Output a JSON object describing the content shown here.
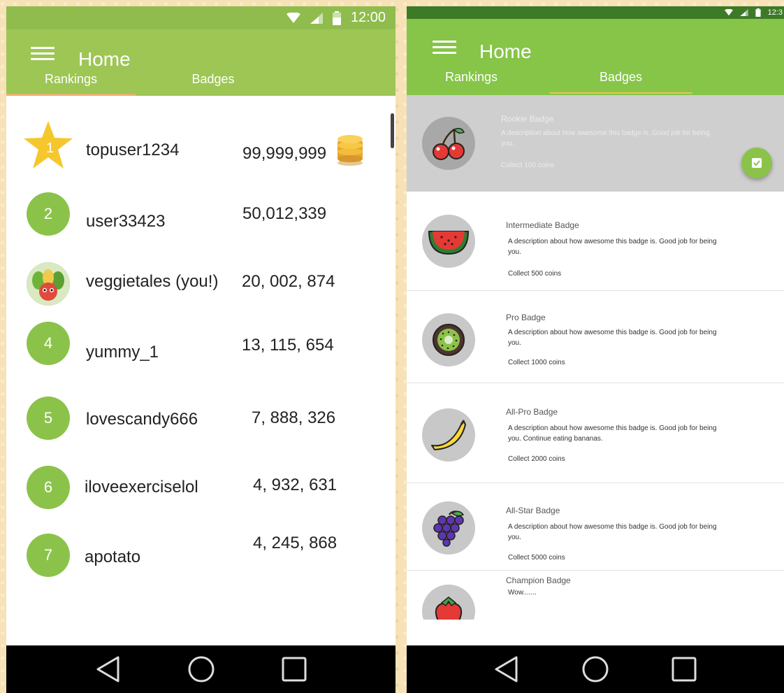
{
  "left": {
    "status": {
      "time": "12:00"
    },
    "title": "Home",
    "tabs": [
      {
        "label": "Rankings",
        "selected": true
      },
      {
        "label": "Badges",
        "selected": false
      }
    ],
    "rankings": [
      {
        "rank": "1",
        "name": "topuser1234",
        "score": "99,999,999"
      },
      {
        "rank": "2",
        "name": "user33423",
        "score": "50,012,339"
      },
      {
        "rank": "",
        "name": "veggietales (you!)",
        "score": "20, 002, 874"
      },
      {
        "rank": "4",
        "name": "yummy_1",
        "score": "13, 115, 654"
      },
      {
        "rank": "5",
        "name": "lovescandy666",
        "score": "7, 888, 326"
      },
      {
        "rank": "6",
        "name": "iloveexerciselol",
        "score": "4, 932, 631"
      },
      {
        "rank": "7",
        "name": "apotato",
        "score": "4, 245, 868"
      }
    ]
  },
  "right": {
    "status": {
      "time": "12:3"
    },
    "title": "Home",
    "tabs": [
      {
        "label": "Rankings",
        "selected": false
      },
      {
        "label": "Badges",
        "selected": true
      }
    ],
    "badges": [
      {
        "name": "Rookie Badge",
        "desc": "A description about how awesome this badge is. Good job for being you.",
        "collect": "Collect 100 coins",
        "icon": "cherry-icon",
        "active": true
      },
      {
        "name": "Intermediate Badge",
        "desc": "A description about how awesome this badge is. Good job for being you.",
        "collect": "Collect 500 coins",
        "icon": "watermelon-icon"
      },
      {
        "name": "Pro Badge",
        "desc": "A description about how awesome this badge is. Good job for being you.",
        "collect": "Collect 1000 coins",
        "icon": "kiwi-icon"
      },
      {
        "name": "All-Pro Badge",
        "desc": "A description about how awesome this badge is. Good job for being you. Continue eating bananas.",
        "collect": "Collect 2000 coins",
        "icon": "banana-icon"
      },
      {
        "name": "All-Star Badge",
        "desc": "A description about how awesome this badge is. Good job for being you.",
        "collect": "Collect 5000 coins",
        "icon": "grapes-icon"
      },
      {
        "name": "Champion Badge",
        "desc": "Wow.......",
        "collect": "",
        "icon": "strawberry-icon"
      }
    ]
  },
  "colors": {
    "accent_green": "#8bc34a",
    "left_appbar": "#9dc654",
    "right_appbar": "#86c548"
  }
}
